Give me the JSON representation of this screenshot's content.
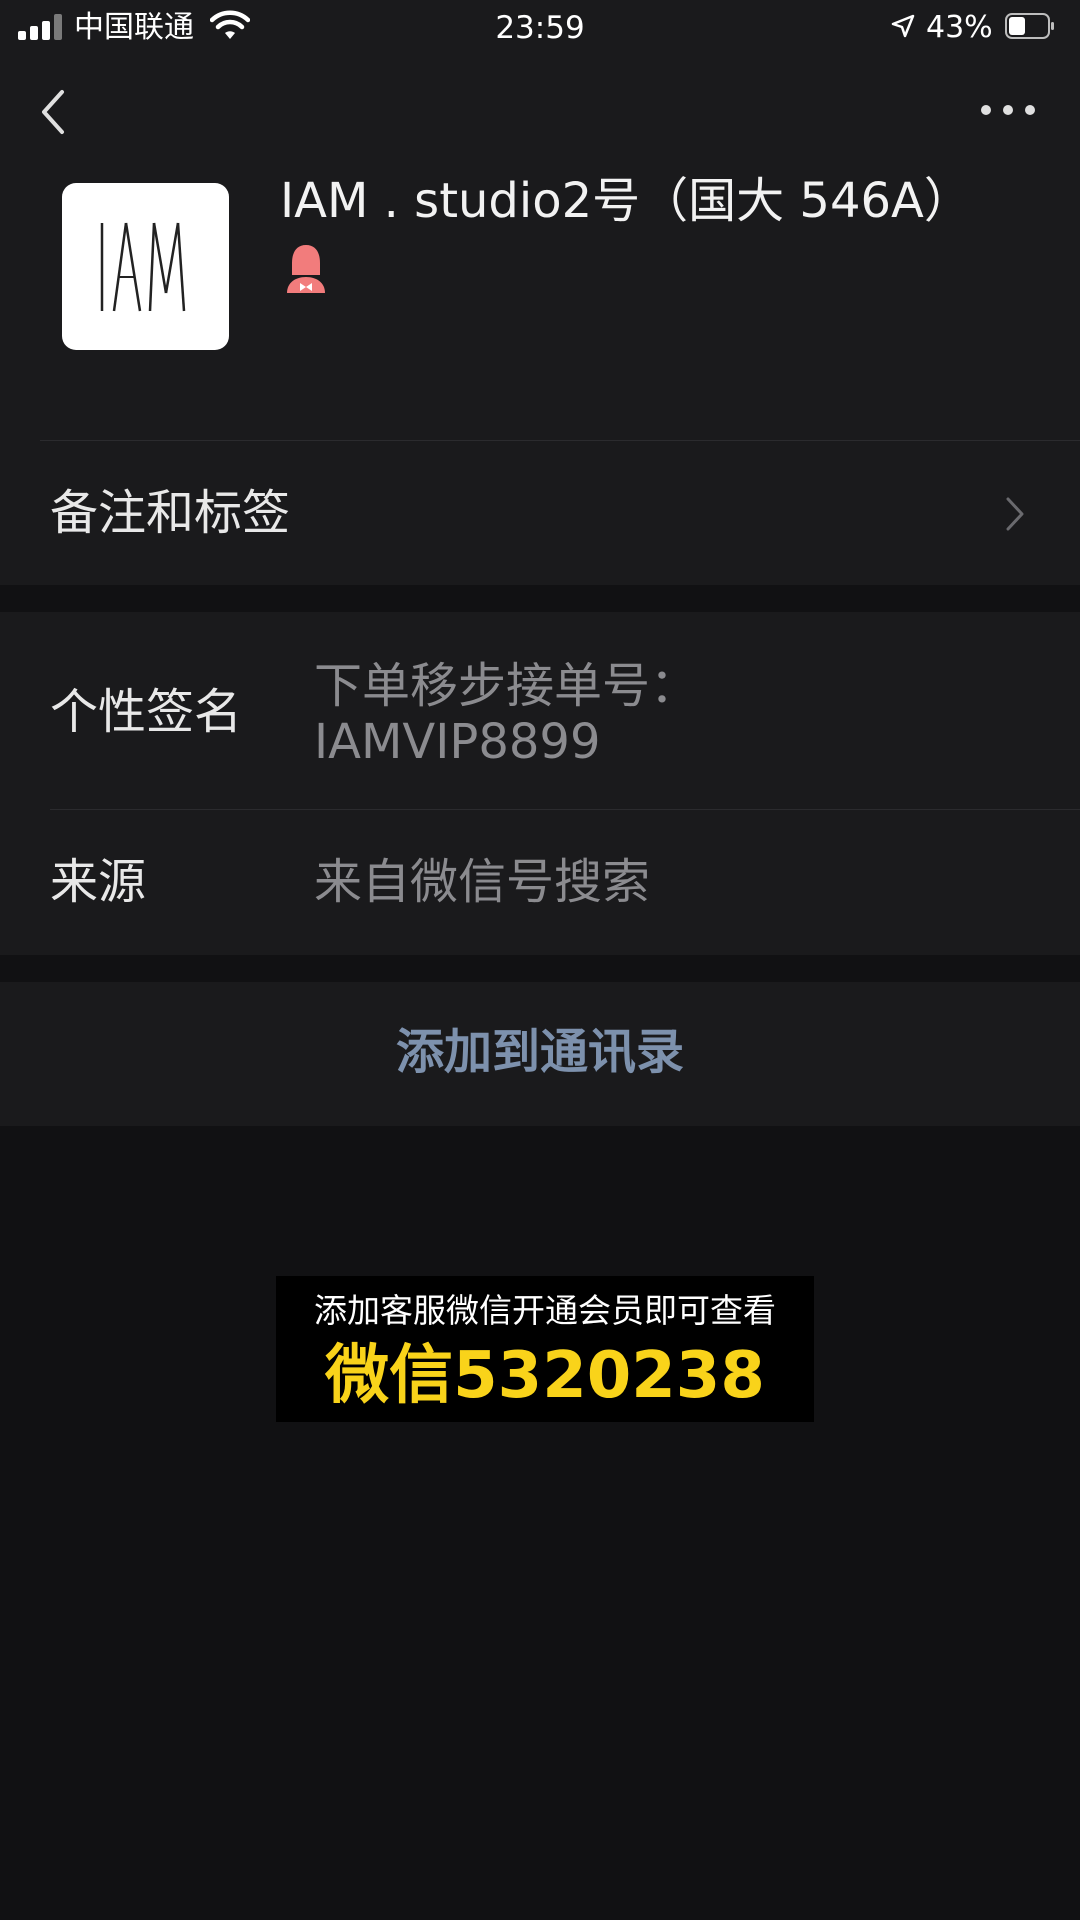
{
  "status_bar": {
    "carrier": "中国联通",
    "time": "23:59",
    "battery": "43%",
    "battery_level": 0.43
  },
  "profile": {
    "name": "IAM . studio2号（国大 546A）",
    "avatar_logo_text": "IAM",
    "gender_icon": "female-icon"
  },
  "rows": {
    "remark_label": "备注和标签",
    "signature_label": "个性签名",
    "signature_value_line1": "下单移步接单号：",
    "signature_value_line2": "IAMVIP8899",
    "source_label": "来源",
    "source_value": "来自微信号搜索"
  },
  "actions": {
    "add_contact": "添加到通讯录"
  },
  "promo": {
    "line1": "添加客服微信开通会员即可查看",
    "line2": "微信5320238"
  },
  "colors": {
    "background": "#111113",
    "panel": "#1a1a1c",
    "link": "#7d91ad",
    "promo_highlight": "#f9d31a"
  }
}
